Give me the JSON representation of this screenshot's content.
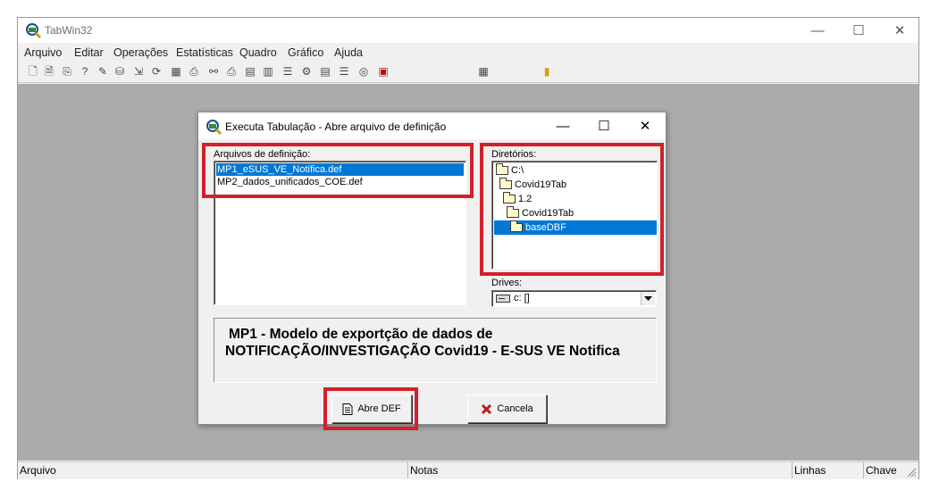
{
  "app": {
    "title": "TabWin32",
    "controls": {
      "minimize": "—",
      "maximize": "☐",
      "close": "✕"
    }
  },
  "menu": [
    "Arquivo",
    "Editar",
    "Operações",
    "Estatísticas",
    "Quadro",
    "Gráfico",
    "Ajuda"
  ],
  "toolbar": {
    "icons": [
      "new-file-icon",
      "open-file-icon",
      "copy-icon",
      "help-icon",
      "edit-icon",
      "tabulate-icon",
      "import-icon",
      "refresh-icon",
      "calculator-icon",
      "print-preview-icon",
      "binoculars-icon",
      "print-icon",
      "table-icon",
      "columns-icon",
      "list-icon",
      "filter-icon",
      "sort-icon",
      "list-alt-icon",
      "globe-icon",
      "stop-icon",
      "grid-icon",
      "exit-icon"
    ],
    "glyphs": [
      "🗋",
      "🗎",
      "⎘",
      "?",
      "✎",
      "⛁",
      "⇲",
      "⟳",
      "▦",
      "⎙",
      "⚯",
      "⎙",
      "▤",
      "▥",
      "☰",
      "⚙",
      "▤",
      "☰",
      "◎",
      "▣",
      "▦",
      "▮"
    ]
  },
  "dialog": {
    "title": "Executa Tabulação - Abre arquivo de definição",
    "controls": {
      "minimize": "—",
      "maximize": "☐",
      "close": "✕"
    },
    "files_label": "Arquivos de definição:",
    "files": [
      "MP1_eSUS_VE_Notifica.def",
      "MP2_dados_unificados_COE.def"
    ],
    "selected_file": "MP1_eSUS_VE_Notifica.def",
    "directories_label": "Diretórios:",
    "directories": [
      "C:\\",
      "Covid19Tab",
      "1.2",
      "Covid19Tab",
      "baseDBF"
    ],
    "selected_directory": "baseDBF",
    "drives_label": "Drives:",
    "drive_value": "c: []",
    "description_line1": "MP1 - Modelo de exportção de dados de",
    "description_line2": "NOTIFICAÇÃO/INVESTIGAÇÃO Covid19 - E-SUS VE Notifica",
    "open_button": "Abre DEF",
    "cancel_button": "Cancela",
    "highlight_color": "#d3202a",
    "selection_color": "#0078d7"
  },
  "status": {
    "left": "Arquivo",
    "notes": "Notas",
    "rows": "Linhas",
    "key": "Chave"
  }
}
